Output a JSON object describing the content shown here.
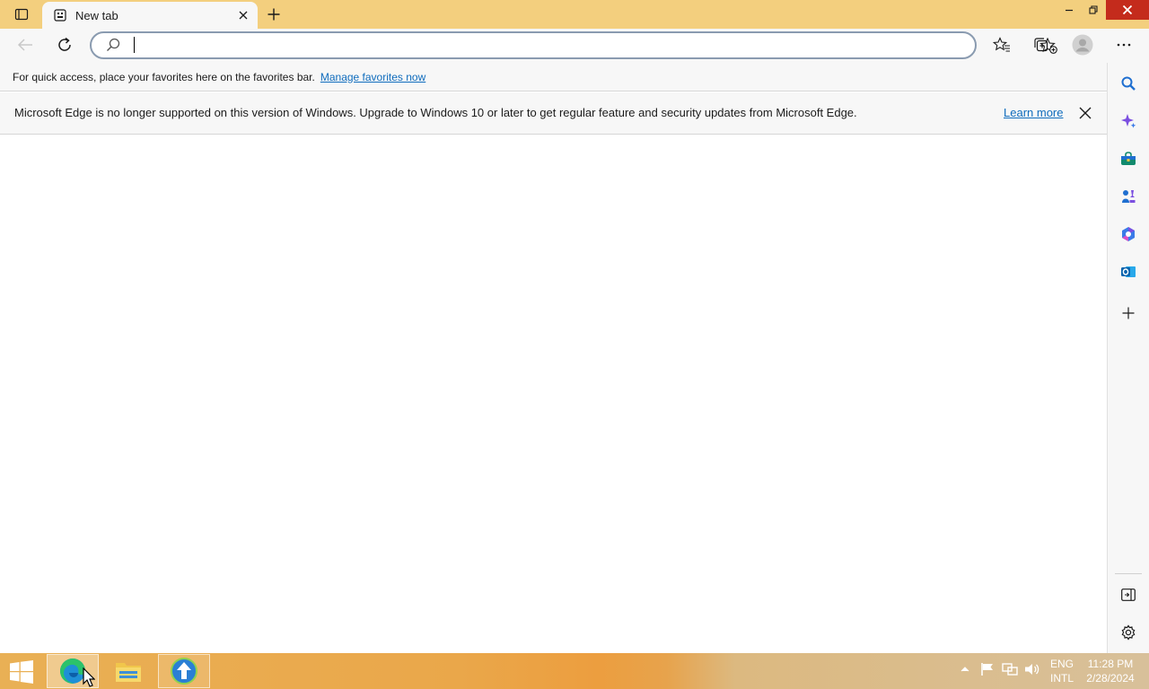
{
  "browser": {
    "tab": {
      "title": "New tab"
    },
    "address": {
      "value": "",
      "placeholder": ""
    },
    "favorites_bar": {
      "text": "For quick access, place your favorites here on the favorites bar.",
      "link": "Manage favorites now"
    },
    "infobar": {
      "message": "Microsoft Edge is no longer supported on this version of Windows. Upgrade to Windows 10 or later to get regular feature and security updates from Microsoft Edge.",
      "link": "Learn more"
    },
    "sidebar": {
      "items": [
        "search-icon",
        "copilot-icon",
        "shopping-icon",
        "games-icon",
        "office-icon",
        "outlook-icon",
        "add-icon"
      ],
      "bottom": [
        "hide-sidebar-icon",
        "settings-icon"
      ]
    }
  },
  "taskbar": {
    "apps": [
      "edge-icon",
      "file-explorer-icon",
      "app-icon"
    ],
    "language": {
      "line1": "ENG",
      "line2": "INTL"
    },
    "clock": {
      "time": "11:28 PM",
      "date": "2/28/2024"
    }
  },
  "colors": {
    "titlebar": "#f3cf7e",
    "accent": "#0f6cbd",
    "close": "#c42b1c"
  }
}
